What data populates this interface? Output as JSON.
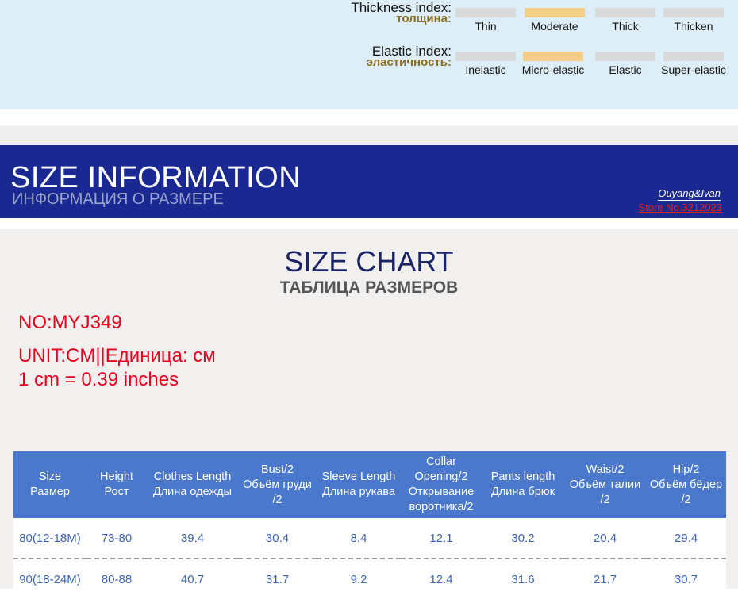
{
  "thickness": {
    "label_en": "Thickness index:",
    "label_ru": "толщина:",
    "options": [
      "Thin",
      "Moderate",
      "Thick",
      "Thicken"
    ],
    "selected": "Moderate"
  },
  "elastic": {
    "label_en": "Elastic index:",
    "label_ru": "эластичность:",
    "options": [
      "Inelastic",
      "Micro-elastic",
      "Elastic",
      "Super-elastic"
    ],
    "selected": "Micro-elastic"
  },
  "banner": {
    "title": "SIZE INFORMATION",
    "subtitle": "ИНФОРМАЦИЯ О РАЗМЕРЕ",
    "brand": "Ouyang&Ivan",
    "store": "Store No.3212023"
  },
  "chart": {
    "title": "SIZE CHART",
    "subtitle": "ТАБЛИЦА РАЗМЕРОВ",
    "model_no": "NO:MYJ349",
    "unit": "UNIT:CM||Единица: см",
    "conversion": "1 cm = 0.39 inches"
  },
  "colors": {
    "banner_bg": "#1a2891",
    "table_header_bg": "#4a78cc",
    "accent_red": "#e8001c",
    "selected_bar": "#f3cf86"
  },
  "table": {
    "headers": [
      [
        "Size",
        "Размер"
      ],
      [
        "Height",
        "Рост"
      ],
      [
        "Clothes Length",
        "Длина одежды"
      ],
      [
        "Bust/2",
        "Объём груди",
        "/2"
      ],
      [
        "Sleeve Length",
        "Длина рукава"
      ],
      [
        "Collar",
        "Opening/2",
        "Открывание",
        "воротника/2"
      ],
      [
        "Pants length",
        "Длина брюк"
      ],
      [
        "Waist/2",
        "Объём талии",
        "/2"
      ],
      [
        "Hip/2",
        "Объём бёдер",
        "/2"
      ]
    ],
    "rows": [
      [
        "80(12-18M)",
        "73-80",
        "39.4",
        "30.4",
        "8.4",
        "12.1",
        "30.2",
        "20.4",
        "29.4"
      ],
      [
        "90(18-24M)",
        "80-88",
        "40.7",
        "31.7",
        "9.2",
        "12.4",
        "31.6",
        "21.7",
        "30.7"
      ]
    ]
  }
}
